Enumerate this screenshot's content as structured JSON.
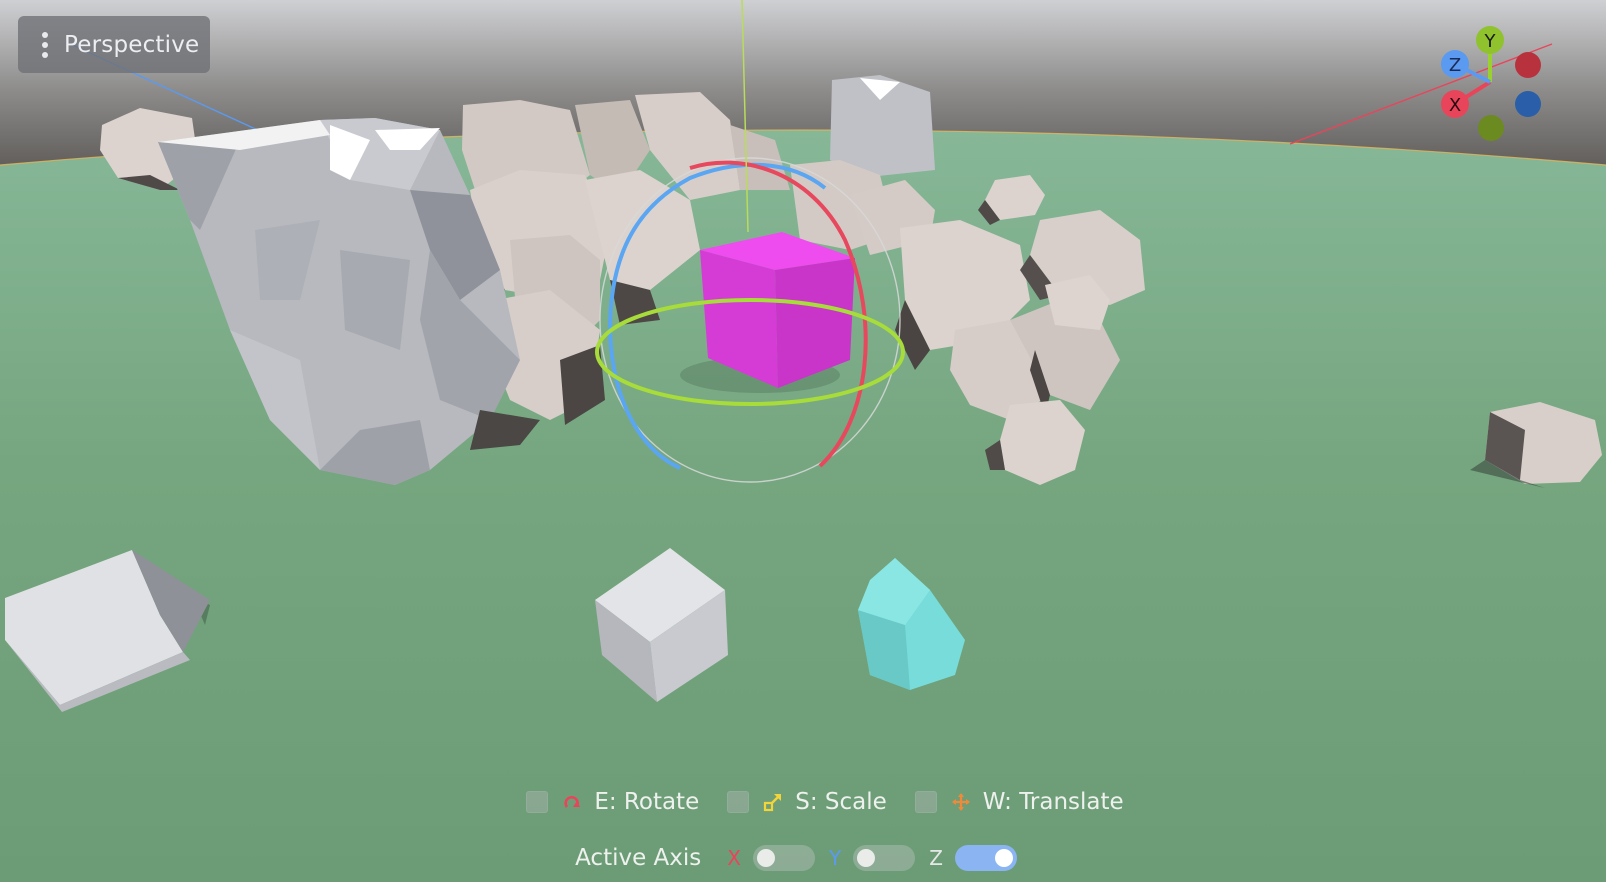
{
  "viewport": {
    "view_menu": {
      "icon": "kebab-menu-icon",
      "label": "Perspective"
    }
  },
  "axis_gizmo": {
    "y_label": "Y",
    "z_label": "Z",
    "x_label": "X"
  },
  "toolbar": {
    "rotate": {
      "label": "E: Rotate",
      "icon": "rotate-icon",
      "checked": false
    },
    "scale": {
      "label": "S: Scale",
      "icon": "scale-icon",
      "checked": false
    },
    "translate": {
      "label": "W: Translate",
      "icon": "translate-icon",
      "checked": false
    }
  },
  "active_axis": {
    "title": "Active Axis",
    "x": {
      "label": "X",
      "on": false
    },
    "y": {
      "label": "Y",
      "on": false
    },
    "z": {
      "label": "Z",
      "on": true
    }
  },
  "colors": {
    "axis_x": "#e8455b",
    "axis_y": "#9bd12f",
    "axis_z": "#5a9af0",
    "ground": "#73a57c",
    "selected_cube": "#d838d8",
    "crystal": "#72dcda"
  }
}
